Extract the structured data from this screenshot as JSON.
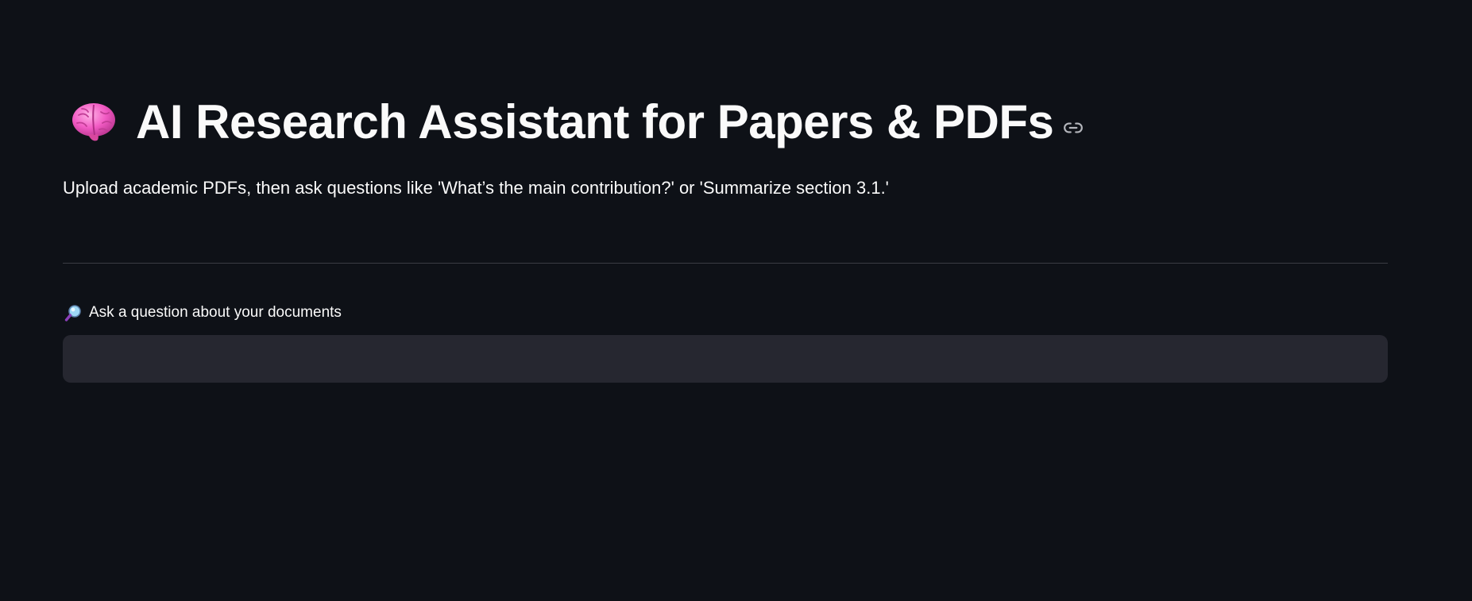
{
  "page": {
    "background": "#0e1117",
    "title": "AI Research Assistant for Papers & PDFs",
    "title_icon": "brain-icon",
    "anchor_icon": "link-icon",
    "subtitle": "Upload academic PDFs, then ask questions like 'What’s the main contribution?' or 'Summarize section 3.1.'"
  },
  "question": {
    "label": "Ask a question about your documents",
    "label_icon": "magnifier-icon",
    "value": "",
    "input_background": "#262730"
  }
}
